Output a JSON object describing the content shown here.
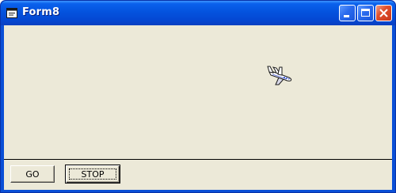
{
  "window": {
    "title": "Form8",
    "controls": {
      "minimize": "minimize-icon",
      "maximize": "maximize-icon",
      "close": "close-icon"
    }
  },
  "colors": {
    "titlebar": "#0453de",
    "client_background": "#ece9d8",
    "close_button": "#e1502c"
  },
  "canvas": {
    "sprite": "airplane-icon"
  },
  "buttons": {
    "go_label": "GO",
    "stop_label": "STOP"
  }
}
